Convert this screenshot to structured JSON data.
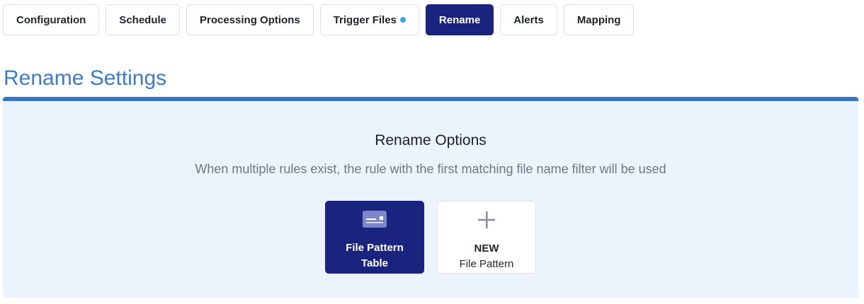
{
  "tabs": [
    {
      "label": "Configuration",
      "active": false
    },
    {
      "label": "Schedule",
      "active": false
    },
    {
      "label": "Processing Options",
      "active": false
    },
    {
      "label": "Trigger Files",
      "active": false,
      "indicator": "status-dot"
    },
    {
      "label": "Rename",
      "active": true
    },
    {
      "label": "Alerts",
      "active": false
    },
    {
      "label": "Mapping",
      "active": false
    }
  ],
  "colors": {
    "accent_navy": "#1a237e",
    "title_blue": "#3d7bc4",
    "panel_border": "#3975c7",
    "panel_bg": "#edf3fc",
    "indicator_dot": "#3ba3e6"
  },
  "page": {
    "title": "Rename Settings"
  },
  "rename_panel": {
    "title": "Rename Options",
    "description": "When multiple rules exist, the rule with the first matching file name filter will be used",
    "cards": [
      {
        "line1": "File Pattern",
        "line2": "Table",
        "icon": "card-table-icon"
      },
      {
        "line1": "NEW",
        "line2": "File Pattern",
        "icon": "plus-icon"
      }
    ]
  }
}
